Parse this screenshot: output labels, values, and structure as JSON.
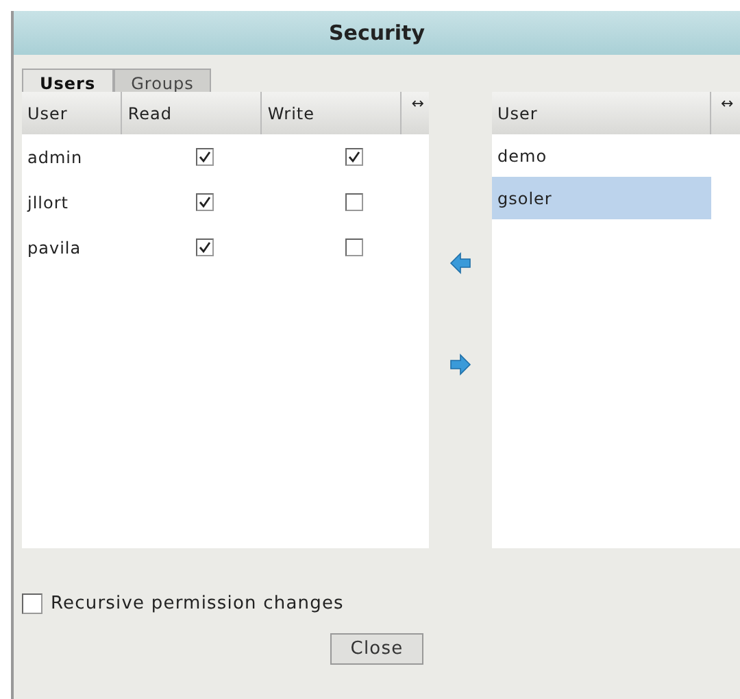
{
  "window": {
    "title": "Security"
  },
  "tabs": [
    {
      "label": "Users",
      "selected": true
    },
    {
      "label": "Groups",
      "selected": false
    }
  ],
  "permissions_table": {
    "columns": [
      "User",
      "Read",
      "Write"
    ],
    "resize_handle": "↔",
    "rows": [
      {
        "user": "admin",
        "read": true,
        "write": true
      },
      {
        "user": "jllort",
        "read": true,
        "write": false
      },
      {
        "user": "pavila",
        "read": true,
        "write": false
      }
    ]
  },
  "users_list": {
    "column": "User",
    "resize_handle": "↔",
    "items": [
      {
        "label": "demo",
        "selected": false
      },
      {
        "label": "gsoler",
        "selected": true
      }
    ]
  },
  "recursive_option": {
    "label": "Recursive permission changes",
    "checked": false
  },
  "buttons": [
    "Close"
  ]
}
